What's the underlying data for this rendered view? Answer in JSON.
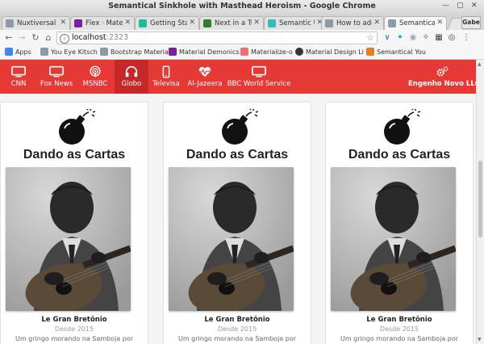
{
  "window": {
    "title": "Semantical Sinkhole with Masthead Heroism - Google Chrome"
  },
  "tabs": [
    {
      "label": "Nuxtiversal",
      "color": "#8a9ba8"
    },
    {
      "label": "Flex · Materi",
      "color": "#7b1fa2"
    },
    {
      "label": "Getting Star",
      "color": "#1abc9c"
    },
    {
      "label": "Next in a Tu",
      "color": "#2e7d32"
    },
    {
      "label": "Semantic U",
      "color": "#35bdb2"
    },
    {
      "label": "How to add",
      "color": "#8a9ba8"
    },
    {
      "label": "Semantical",
      "color": "#8a9ba8"
    }
  ],
  "user_badge": "Gabe",
  "omnibox": {
    "host": "localhost",
    "port": ":2323"
  },
  "bookmarks": [
    {
      "label": "Apps",
      "color": "#4285f4"
    },
    {
      "label": "You Eye Kitsch",
      "color": "#8a9ba8"
    },
    {
      "label": "Bootstrap Materia",
      "color": "#8a9ba8"
    },
    {
      "label": "Material Demonics",
      "color": "#7b1fa2"
    },
    {
      "label": "Materialize-o",
      "color": "#ee6e73"
    },
    {
      "label": "Material Design Li",
      "color": "#333333"
    },
    {
      "label": "Semantical You",
      "color": "#e67e22"
    }
  ],
  "masthead": {
    "brand_label": "Engenho Novo LLC",
    "items": [
      {
        "label": "CNN",
        "icon": "tv-icon"
      },
      {
        "label": "Fox News",
        "icon": "tv-icon"
      },
      {
        "label": "MSNBC",
        "icon": "podcast-icon"
      },
      {
        "label": "Globo",
        "icon": "headphones-icon"
      },
      {
        "label": "Televisa",
        "icon": "mobile-icon"
      },
      {
        "label": "Al-Jazeera",
        "icon": "heartbeat-icon"
      },
      {
        "label": "BBC World Service",
        "icon": "tv-icon"
      }
    ]
  },
  "cards": [
    {
      "title": "Dando as Cartas",
      "name": "Le Gran Bretônio",
      "since": "Desde 2015",
      "desc": "Um gringo morando na Samboja por"
    },
    {
      "title": "Dando as Cartas",
      "name": "Le Gran Bretônio",
      "since": "Desde 2015",
      "desc": "Um gringo morando na Samboja por"
    },
    {
      "title": "Dando as Cartas",
      "name": "Le Gran Bretônio",
      "since": "Desde 2015",
      "desc": "Um gringo morando na Samboja por"
    }
  ],
  "colors": {
    "masthead": "#e53935",
    "masthead_active": "#c62828"
  }
}
